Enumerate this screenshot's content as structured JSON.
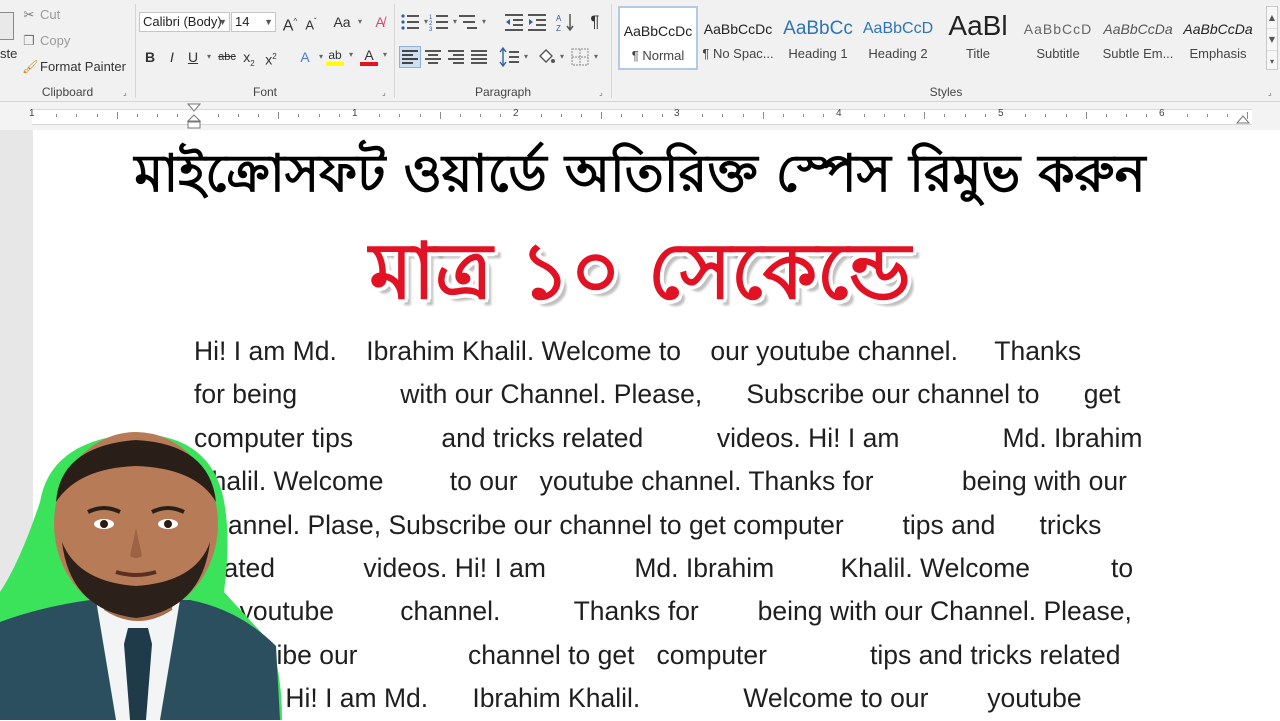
{
  "ribbon": {
    "clipboard": {
      "paste_label": "ste",
      "cut_label": "Cut",
      "copy_label": "Copy",
      "format_painter_label": "Format Painter",
      "group_label": "Clipboard"
    },
    "font": {
      "font_name": "Calibri (Body)",
      "font_size": "14",
      "grow_label": "A",
      "shrink_label": "A",
      "case_label": "Aa",
      "bold_label": "B",
      "italic_label": "I",
      "underline_label": "U",
      "strike_label": "abc",
      "subscript_label": "x",
      "superscript_label": "x",
      "text_effects_label": "A",
      "highlight_label": "ab",
      "font_color_label": "A",
      "highlight_color": "#ffff00",
      "font_color": "#e11224",
      "group_label": "Font"
    },
    "paragraph": {
      "show_marks_label": "¶",
      "group_label": "Paragraph"
    },
    "styles": {
      "items": [
        {
          "sample": "AaBbCcDc",
          "name": "¶ Normal"
        },
        {
          "sample": "AaBbCcDc",
          "name": "¶ No Spac..."
        },
        {
          "sample": "AaBbCc",
          "name": "Heading 1"
        },
        {
          "sample": "AaBbCcD",
          "name": "Heading 2"
        },
        {
          "sample": "AaBl",
          "name": "Title"
        },
        {
          "sample": "AaBbCcD",
          "name": "Subtitle"
        },
        {
          "sample": "AaBbCcDa",
          "name": "Subtle Em..."
        },
        {
          "sample": "AaBbCcDa",
          "name": "Emphasis"
        }
      ],
      "group_label": "Styles"
    }
  },
  "ruler": {
    "numbers": [
      "1",
      "1",
      "2",
      "3",
      "4",
      "5",
      "6"
    ]
  },
  "overlay": {
    "title_bn": "মাইক্রোসফট ওয়ার্ডে অতিরিক্ত স্পেস রিমুভ করুন",
    "title_red": "মাত্র ১০ সেকেন্ডে",
    "title_red_color": "#e11224"
  },
  "document": {
    "lines": [
      "Hi! I am Md.    Ibrahim Khalil. Welcome to    our youtube channel.     Thanks",
      "for being              with our Channel. Please,      Subscribe our channel to      get",
      "computer tips            and tricks related          videos. Hi! I am              Md. Ibrahim",
      "Khalil. Welcome         to our   youtube channel. Thanks for            being with our",
      "Channel. Plase, Subscribe our channel to get computer        tips and      tricks",
      "related            videos. Hi! I am            Md. Ibrahim         Khalil. Welcome           to",
      "our youtube         channel.          Thanks for        being with our Channel. Please,",
      "Subscribe our               channel to get   computer              tips and tricks related",
      "videos. Hi! I am Md.      Ibrahim Khalil.              Welcome to our        youtube"
    ]
  }
}
